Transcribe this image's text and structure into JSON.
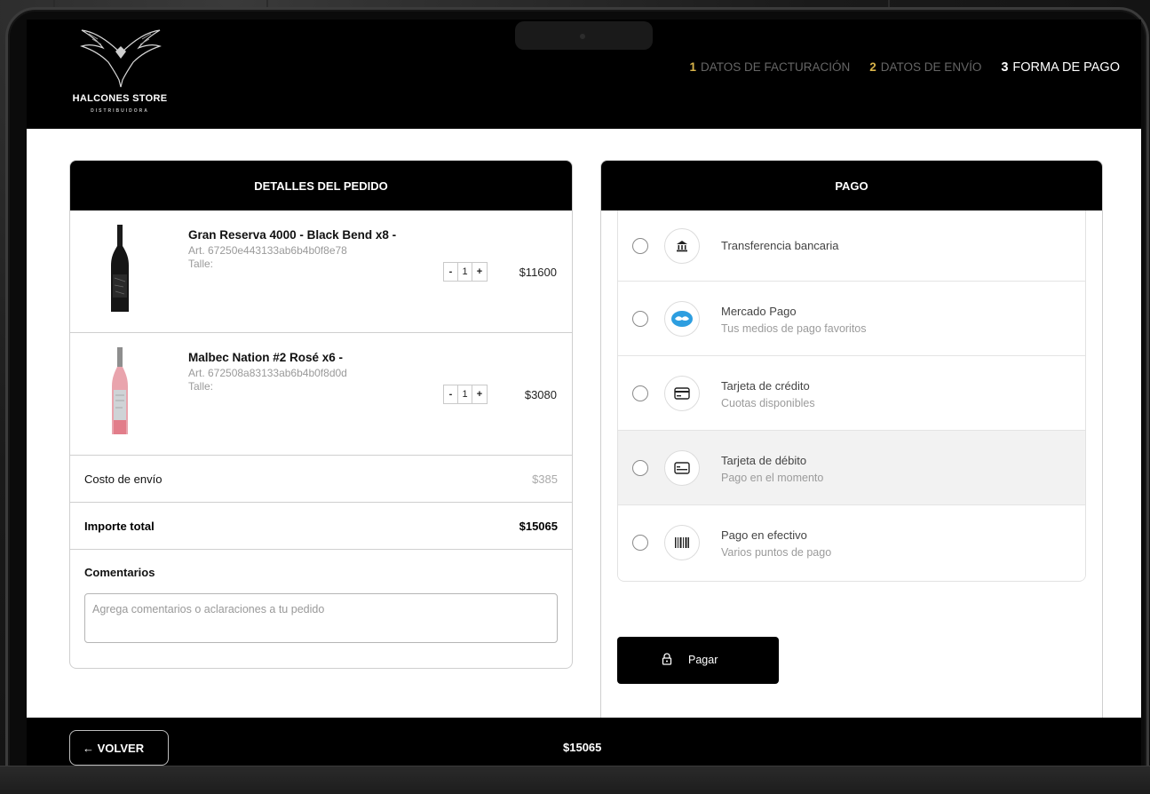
{
  "brand": {
    "name": "HALCONES STORE",
    "subtitle": "DISTRIBUIDORA"
  },
  "steps": [
    {
      "num": "1",
      "label": "DATOS DE FACTURACIÓN",
      "active": false
    },
    {
      "num": "2",
      "label": "DATOS DE ENVÍO",
      "active": false
    },
    {
      "num": "3",
      "label": "FORMA DE PAGO",
      "active": true
    }
  ],
  "order": {
    "title": "DETALLES DEL PEDIDO",
    "items": [
      {
        "name": "Gran Reserva 4000 - Black Bend x8 -",
        "art": "Art. 67250e443133ab6b4b0f8e78",
        "talle": "Talle:",
        "qty_minus": "-",
        "qty": "1",
        "qty_plus": "+",
        "price": "$11600",
        "image": "red-wine-bottle"
      },
      {
        "name": "Malbec Nation #2 Rosé x6 -",
        "art": "Art. 672508a83133ab6b4b0f8d0d",
        "talle": "Talle:",
        "qty_minus": "-",
        "qty": "1",
        "qty_plus": "+",
        "price": "$3080",
        "image": "rose-wine-bottle"
      }
    ],
    "shipping_label": "Costo de envío",
    "shipping_value": "$385",
    "total_label": "Importe total",
    "total_value": "$15065",
    "comments_label": "Comentarios",
    "comments_placeholder": "Agrega comentarios o aclaraciones a tu pedido"
  },
  "payment": {
    "title": "PAGO",
    "methods": [
      {
        "title": "Transferencia bancaria",
        "subtitle": "",
        "icon": "bank-icon"
      },
      {
        "title": "Mercado Pago",
        "subtitle": "Tus medios de pago favoritos",
        "icon": "mercado-pago-icon"
      },
      {
        "title": "Tarjeta de crédito",
        "subtitle": "Cuotas disponibles",
        "icon": "credit-card-icon"
      },
      {
        "title": "Tarjeta de débito",
        "subtitle": "Pago en el momento",
        "icon": "debit-card-icon"
      },
      {
        "title": "Pago en efectivo",
        "subtitle": "Varios puntos de pago",
        "icon": "barcode-icon"
      }
    ],
    "pay_button": "Pagar"
  },
  "footer": {
    "back_label": "← VOLVER",
    "total": "$15065"
  },
  "colors": {
    "step_number": "#d9b44a",
    "header_bg": "#000000",
    "mercado_pago_blue": "#2d9ee0"
  }
}
